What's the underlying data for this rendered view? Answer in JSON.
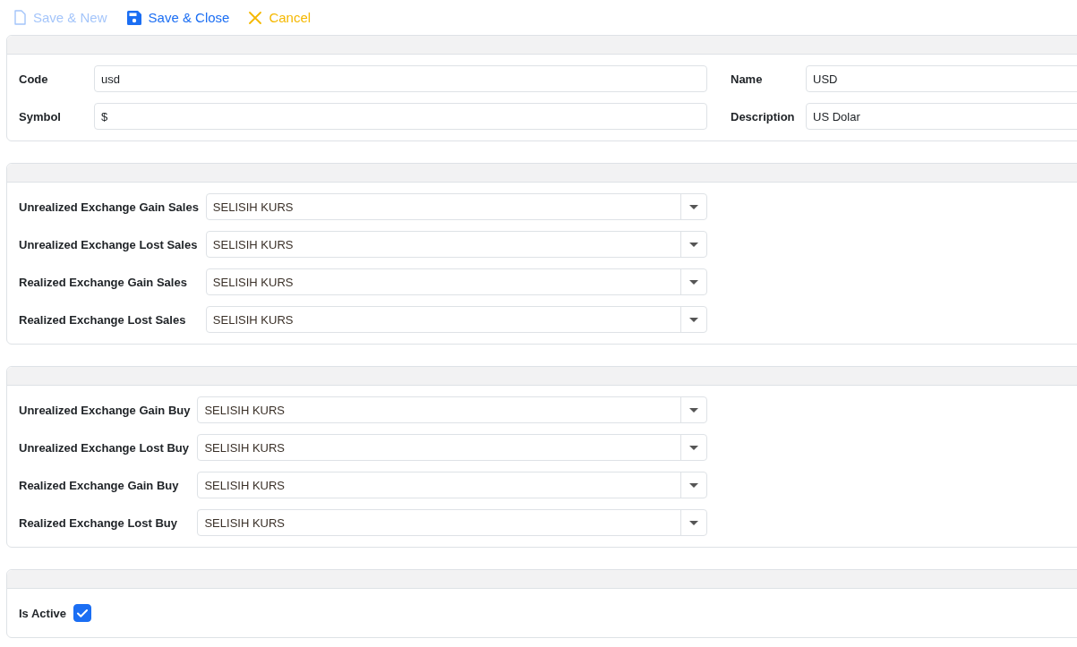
{
  "toolbar": [
    {
      "label": "Save & New",
      "kind": "new",
      "disabled": true
    },
    {
      "label": "Save & Close",
      "kind": "save",
      "disabled": false
    },
    {
      "label": "Cancel",
      "kind": "cancel",
      "disabled": false
    }
  ],
  "general_panel": {
    "fields": [
      {
        "label": "Code",
        "value": "usd"
      },
      {
        "label": "Name",
        "value": "USD"
      },
      {
        "label": "Symbol",
        "value": "$"
      },
      {
        "label": "Description",
        "value": "US Dolar"
      }
    ]
  },
  "sales_accounts_panel": {
    "fields": [
      {
        "label": "Unrealized Exchange Gain Sales",
        "value": "SELISIH KURS"
      },
      {
        "label": "Unrealized Exchange Lost Sales",
        "value": "SELISIH KURS"
      },
      {
        "label": "Realized Exchange Gain Sales",
        "value": "SELISIH KURS"
      },
      {
        "label": "Realized Exchange Lost Sales",
        "value": "SELISIH KURS"
      }
    ]
  },
  "buy_accounts_panel": {
    "fields": [
      {
        "label": "Unrealized Exchange Gain Buy",
        "value": "SELISIH KURS"
      },
      {
        "label": "Unrealized Exchange Lost Buy",
        "value": "SELISIH KURS"
      },
      {
        "label": "Realized Exchange Gain Buy",
        "value": "SELISIH KURS"
      },
      {
        "label": "Realized Exchange Lost Buy",
        "value": "SELISIH KURS"
      }
    ]
  },
  "status_panel": {
    "is_active": {
      "label": "Is Active",
      "checked": true
    }
  }
}
